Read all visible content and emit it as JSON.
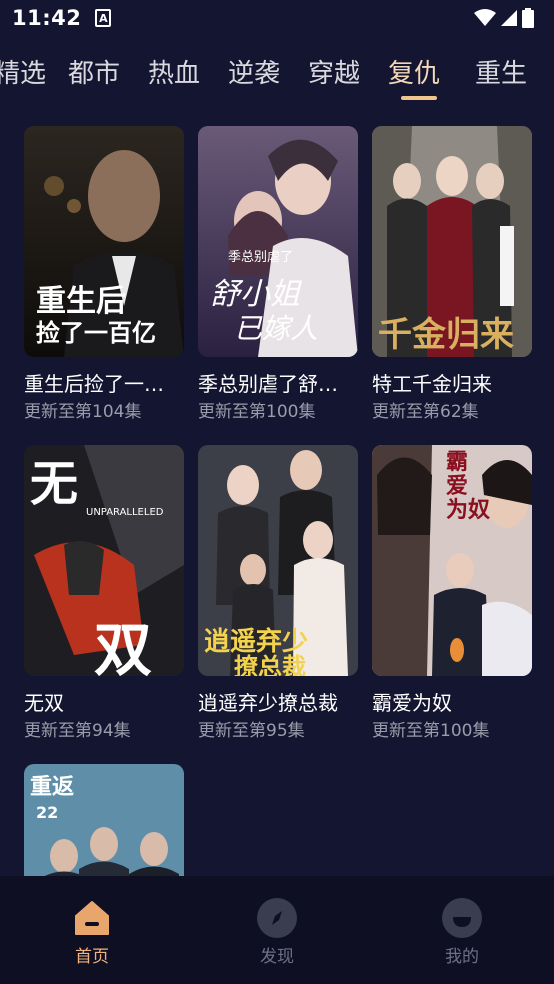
{
  "status_bar": {
    "time": "11:42"
  },
  "tabs": [
    {
      "label": "精选"
    },
    {
      "label": "都市"
    },
    {
      "label": "热血"
    },
    {
      "label": "逆袭"
    },
    {
      "label": "穿越"
    },
    {
      "label": "复仇",
      "active": true
    },
    {
      "label": "重生"
    }
  ],
  "cards": [
    {
      "title": "重生后捡了一…",
      "subtitle": "更新至第104集",
      "poster_text": "重生后 捡了一百亿"
    },
    {
      "title": "季总别虐了舒…",
      "subtitle": "更新至第100集",
      "poster_text": "季总别虐了 舒小姐已嫁人"
    },
    {
      "title": "特工千金归来",
      "subtitle": "更新至第62集",
      "poster_text": "千金归来"
    },
    {
      "title": "无双",
      "subtitle": "更新至第94集",
      "poster_text": "无 双"
    },
    {
      "title": "逍遥弃少撩总裁",
      "subtitle": "更新至第95集",
      "poster_text": "逍遥弃少"
    },
    {
      "title": "霸爱为奴",
      "subtitle": "更新至第100集",
      "poster_text": "霸爱为奴"
    },
    {
      "title": "",
      "subtitle": "",
      "poster_text": "重返 22"
    }
  ],
  "bottom_nav": [
    {
      "label": "首页",
      "icon": "home-icon",
      "active": true
    },
    {
      "label": "发现",
      "icon": "compass-icon"
    },
    {
      "label": "我的",
      "icon": "profile-icon"
    }
  ],
  "colors": {
    "background": "#141631",
    "accent": "#f0c48e",
    "nav_active": "#f0b37d",
    "muted": "#9a9bab"
  }
}
